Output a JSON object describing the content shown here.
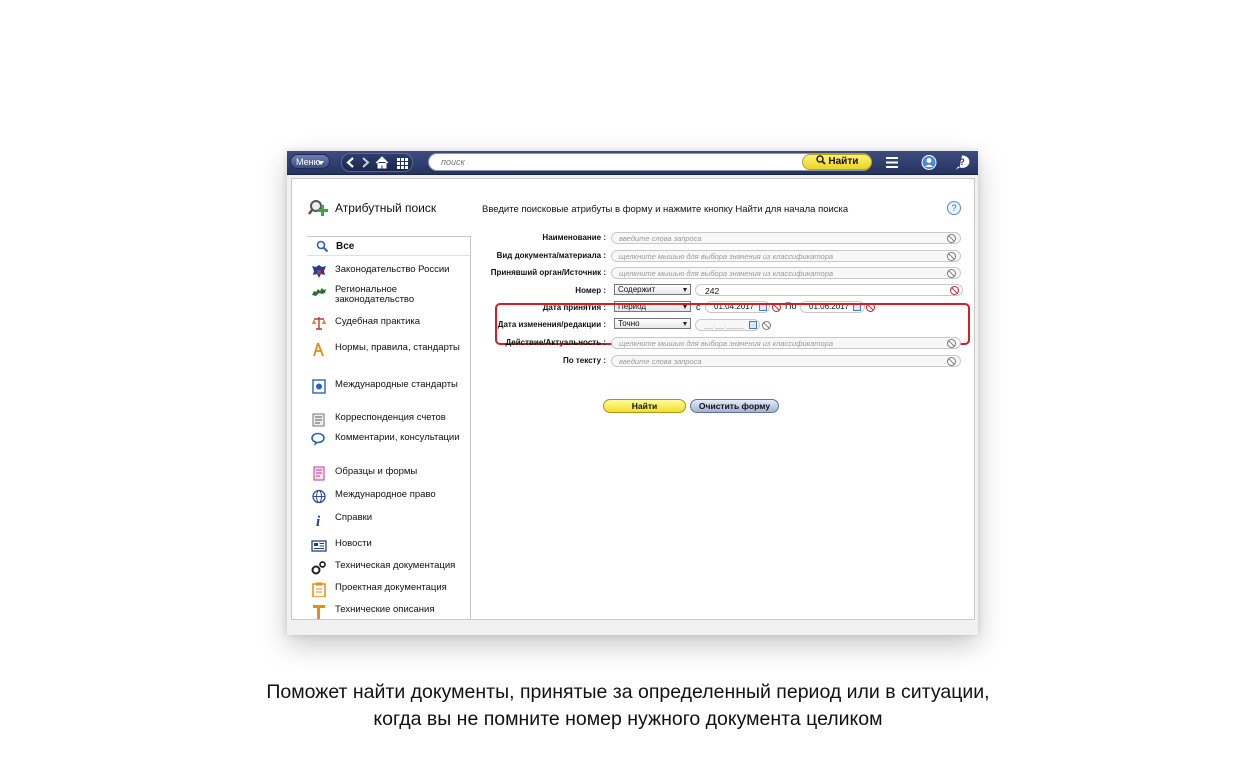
{
  "toolbar": {
    "menu_label": "Меню",
    "search_placeholder": "поиск",
    "search_button": "Найти",
    "icons": [
      "back-arrow-icon",
      "forward-arrow-icon",
      "home-icon",
      "grid-icon",
      "list-menu-icon",
      "user-icon",
      "help-icon"
    ]
  },
  "sidebar": {
    "title": "Атрибутный поиск",
    "selected": "Все",
    "items": [
      {
        "label": "Законодательство России",
        "icon": "russia-emblem-icon"
      },
      {
        "label": "Региональное законодательство",
        "icon": "russia-map-icon"
      },
      {
        "label": "Судебная практика",
        "icon": "scales-icon"
      },
      {
        "label": "Нормы, правила, стандарты",
        "icon": "compass-icon"
      },
      {
        "label": "Международные стандарты",
        "icon": "intl-standards-icon"
      },
      {
        "label": "Корреспонденция счетов",
        "icon": "accounts-icon"
      },
      {
        "label": "Комментарии, консультации",
        "icon": "comments-icon"
      },
      {
        "label": "Образцы и формы",
        "icon": "forms-icon"
      },
      {
        "label": "Международное право",
        "icon": "globe-icon"
      },
      {
        "label": "Справки",
        "icon": "info-icon"
      },
      {
        "label": "Новости",
        "icon": "news-icon"
      },
      {
        "label": "Техническая документация",
        "icon": "gears-icon"
      },
      {
        "label": "Проектная документация",
        "icon": "clipboard-icon"
      },
      {
        "label": "Технические описания",
        "icon": "tech-desc-icon"
      }
    ]
  },
  "form": {
    "intro": "Введите поисковые атрибуты в форму и нажмите кнопку Найти для начала поиска",
    "help_glyph": "?",
    "fields": {
      "name": {
        "label": "Наименование :",
        "placeholder": "введите слова запроса"
      },
      "doc_type": {
        "label": "Вид документа/материала :",
        "placeholder": "щелкните мышью для выбора значения из классификатора"
      },
      "source": {
        "label": "Принявший орган/Источник :",
        "placeholder": "щелкните мышью для выбора значения из классификатора"
      },
      "number": {
        "label": "Номер :",
        "mode": "Содержит",
        "value": "242"
      },
      "adopted": {
        "label": "Дата принятия :",
        "mode": "Период",
        "from_label": "с",
        "from": "01.04.2017",
        "to_label": "По",
        "to": "01.06.2017"
      },
      "modified": {
        "label": "Дата изменения/редакции :",
        "mode": "Точно",
        "value_mask": "__.__.____"
      },
      "status": {
        "label": "Действие/Актуальность :",
        "placeholder": "щелкните мышью для выбора значения из классификатора"
      },
      "text": {
        "label": "По тексту :",
        "placeholder": "введите слова запроса"
      }
    },
    "find_button": "Найти",
    "clear_button": "Очистить форму"
  },
  "caption": {
    "line1": "Поможет найти документы, принятые за определенный период или в ситуации,",
    "line2": "когда вы не помните номер нужного документа целиком"
  }
}
